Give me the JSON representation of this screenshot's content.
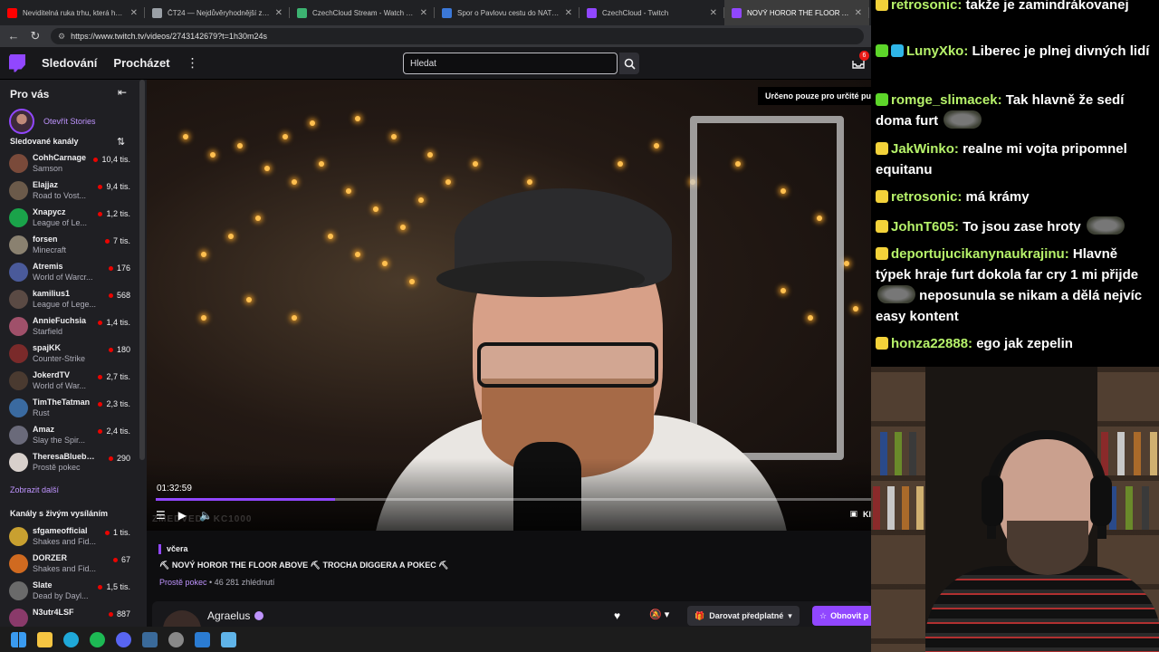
{
  "browser": {
    "tabs": [
      {
        "label": "Neviditelná ruka trhu, která hýbe s...",
        "color": "#ff0000",
        "active": false
      },
      {
        "label": "ČT24 — Nejdůvěryhodnější zpravo...",
        "color": "#9aa0a6",
        "active": false
      },
      {
        "label": "CzechCloud Stream - Watch Live o...",
        "color": "#3cb371",
        "active": false
      },
      {
        "label": "Spor o Pavlovu cestu do NATO: „Je...",
        "color": "#3b78d8",
        "active": false
      },
      {
        "label": "CzechCloud - Twitch",
        "color": "#9147ff",
        "active": false
      },
      {
        "label": "NOVÝ HOROR THE FLOOR ABOVE",
        "color": "#9147ff",
        "active": true
      }
    ],
    "url": "https://www.twitch.tv/videos/2743142679?t=1h30m24s"
  },
  "nav": {
    "following": "Sledování",
    "browse": "Procházet",
    "search_placeholder": "Hledat",
    "inbox_count": "6"
  },
  "sidebar": {
    "for_you": "Pro vás",
    "stories": "Otevřít Stories",
    "followed": "Sledované kanály",
    "followed_channels": [
      {
        "name": "CohhCarnage",
        "game": "Samson",
        "viewers": "10,4 tis.",
        "color": "#7a4a3a"
      },
      {
        "name": "Elajjaz",
        "game": "Road to Vost...",
        "viewers": "9,4 tis.",
        "color": "#6b5a4a"
      },
      {
        "name": "Xnapycz",
        "game": "League of Le...",
        "viewers": "1,2 tis.",
        "color": "#1aa34a"
      },
      {
        "name": "forsen",
        "game": "Minecraft",
        "viewers": "7 tis.",
        "color": "#8a8170"
      },
      {
        "name": "Atremis",
        "game": "World of Warcr...",
        "viewers": "176",
        "color": "#4a5a9a"
      },
      {
        "name": "kamilius1",
        "game": "League of Lege...",
        "viewers": "568",
        "color": "#5a4a44"
      },
      {
        "name": "AnnieFuchsia",
        "game": "Starfield",
        "viewers": "1,4 tis.",
        "color": "#a0506a"
      },
      {
        "name": "spajKK",
        "game": "Counter-Strike",
        "viewers": "180",
        "color": "#7a2a2a"
      },
      {
        "name": "JokerdTV",
        "game": "World of War...",
        "viewers": "2,7 tis.",
        "color": "#4a3a30"
      },
      {
        "name": "TimTheTatman",
        "game": "Rust",
        "viewers": "2,3 tis.",
        "color": "#3a6aa0"
      },
      {
        "name": "Amaz",
        "game": "Slay the Spir...",
        "viewers": "2,4 tis.",
        "color": "#6a6a7a"
      },
      {
        "name": "TheresaBluebe...",
        "game": "Prostě pokec",
        "viewers": "290",
        "color": "#d8d0cc"
      }
    ],
    "show_more": "Zobrazit další",
    "live_channels": "Kanály s živým vysíláním",
    "live_list": [
      {
        "name": "sfgameofficial",
        "game": "Shakes and Fid...",
        "viewers": "1 tis.",
        "color": "#c8a030"
      },
      {
        "name": "DORZER",
        "game": "Shakes and Fid...",
        "viewers": "67",
        "color": "#d06a20"
      },
      {
        "name": "Slate",
        "game": "Dead by Dayl...",
        "viewers": "1,5 tis.",
        "color": "#6a6a6a"
      },
      {
        "name": "N3utr4LSF",
        "game": "",
        "viewers": "887",
        "color": "#8a3a6a"
      }
    ]
  },
  "video": {
    "notice": "Určeno pouze pro určité pu",
    "time": "01:32:59",
    "progress": 0.25,
    "clip_label": "Kl",
    "watermark": "ZMEDVED - KC1000"
  },
  "info": {
    "date": "včera",
    "title": "⛏ NOVÝ HOROR THE FLOOR ABOVE ⛏ TROCHA DIGGERA A POKEC ⛏",
    "category": "Prostě pokec",
    "views": " • 46 281 zhlédnutí",
    "streamer": "Agraelus",
    "gift_label": "Darovat předplatné",
    "renew_label": "Obnovit p"
  },
  "chat": [
    {
      "badges": [
        "yellow"
      ],
      "user": "retrosonic",
      "text": "takže je zamindrákovanej",
      "emote_pos": null
    },
    {
      "badges": [
        "green",
        "blue"
      ],
      "user": "LunyXko",
      "text": "Liberec je plnej divných lidí",
      "emote_pos": null
    },
    {
      "badges": [
        "green"
      ],
      "user": "romge_slimacek",
      "text": "Tak hlavně že sedí doma furt",
      "emote_pos": "end"
    },
    {
      "badges": [
        "yellow"
      ],
      "user": "JakWinko",
      "text": "realne mi vojta pripomnel equitanu",
      "emote_pos": null
    },
    {
      "badges": [
        "yellow"
      ],
      "user": "retrosonic",
      "text": "má krámy",
      "emote_pos": null
    },
    {
      "badges": [
        "yellow"
      ],
      "user": "JohnT605",
      "text": "To jsou zase hroty",
      "emote_pos": "end"
    },
    {
      "badges": [
        "yellow"
      ],
      "user": "deportujucikanynaukrajinu",
      "text_a": "Hlavně týpek hraje furt dokola far cry 1 mi přijde",
      "text_b": "neposunula se nikam a dělá nejvíc easy kontent",
      "emote_pos": "mid"
    },
    {
      "badges": [
        "yellow"
      ],
      "user": "honza22888",
      "text": "ego jak zepelin",
      "emote_pos": null
    }
  ]
}
